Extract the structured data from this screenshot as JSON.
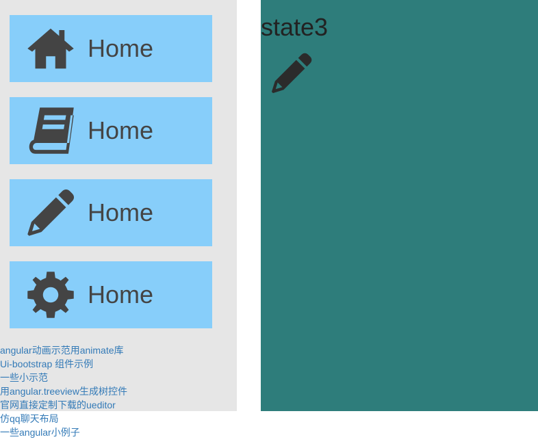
{
  "sidebar": {
    "items": [
      {
        "label": "Home",
        "icon": "home-icon"
      },
      {
        "label": "Home",
        "icon": "book-icon"
      },
      {
        "label": "Home",
        "icon": "pencil-icon"
      },
      {
        "label": "Home",
        "icon": "gear-icon"
      }
    ],
    "links": [
      "angular动画示范用animate库",
      "Ui-bootstrap 组件示例",
      "一些小示范",
      "用angular.treeview生成树控件",
      "官网直接定制下载的ueditor",
      "仿qq聊天布局",
      "一些angular小例子"
    ]
  },
  "main": {
    "title": "state3",
    "icon": "pencil-icon"
  },
  "colors": {
    "sidebar_bg": "#e6e6e6",
    "nav_item_bg": "#87cefa",
    "content_bg": "#2e7d7b",
    "link": "#337ab7",
    "icon": "#444444"
  }
}
